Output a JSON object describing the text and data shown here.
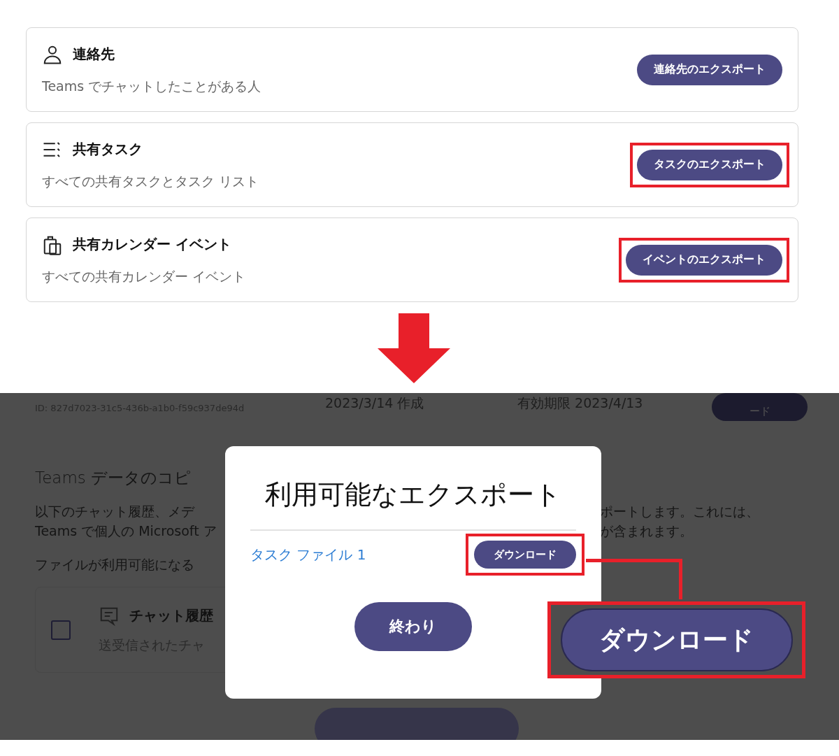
{
  "export_cards": [
    {
      "kind": "person",
      "title": "連絡先",
      "description": "Teams でチャットしたことがある人",
      "button": "連絡先のエクスポート",
      "highlighted": false
    },
    {
      "kind": "tasks",
      "title": "共有タスク",
      "description": "すべての共有タスクとタスク リスト",
      "button": "タスクのエクスポート",
      "highlighted": true
    },
    {
      "kind": "calendar",
      "title": "共有カレンダー イベント",
      "description": "すべての共有カレンダー イベント",
      "button": "イベントのエクスポート",
      "highlighted": true
    }
  ],
  "background_page": {
    "export_row": {
      "id": "ID: 827d7023-31c5-436b-a1b0-f59c937de94d",
      "created": "2023/3/14 作成",
      "expires": "有効期限 2023/4/13",
      "button": "ード"
    },
    "heading": "Teams データのコピ",
    "paragraph": [
      {
        "left": "以下のチャット履歴、メデ",
        "right": "ポートします。これには、"
      },
      {
        "left": "Teams で個人の Microsoft ア",
        "right": "が含まれます。"
      }
    ],
    "note": "ファイルが利用可能になる",
    "option": {
      "checked": false,
      "title": "チャット履歴",
      "description": "送受信されたチャ"
    }
  },
  "dialog": {
    "title": "利用可能なエクスポート",
    "files": [
      {
        "name": "タスク ファイル 1",
        "button": "ダウンロード",
        "highlighted": true
      }
    ],
    "done_button": "終わり"
  },
  "callout": {
    "button": "ダウンロード"
  }
}
